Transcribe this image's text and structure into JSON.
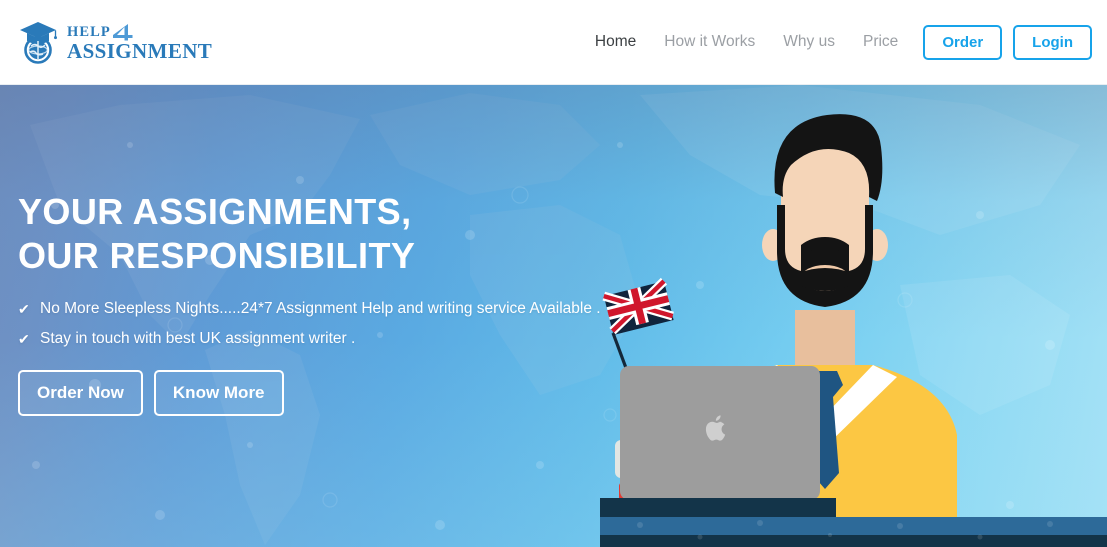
{
  "header": {
    "logo": {
      "icon": "globe-graduation-cap-icon",
      "top_text": "HELP",
      "numeral": "4",
      "bottom_text": "ASSIGNMENT",
      "color": "#2a7ab9"
    },
    "nav_links": [
      {
        "label": "Home",
        "active": true
      },
      {
        "label": "How it Works",
        "active": false
      },
      {
        "label": "Why us",
        "active": false
      },
      {
        "label": "Price",
        "active": false
      }
    ],
    "buttons": [
      {
        "label": "Order",
        "name": "order-button"
      },
      {
        "label": "Login",
        "name": "login-button"
      }
    ],
    "accent_color": "#17a3ea",
    "background": "#ffffff"
  },
  "hero": {
    "title_line1": "YOUR ASSIGNMENTS,",
    "title_line2": "OUR RESPONSIBILITY",
    "bullets": [
      {
        "icon": "check-icon",
        "text": "No More Sleepless Nights.....24*7 Assignment Help and writing service Available ."
      },
      {
        "icon": "check-icon",
        "text": "Stay in touch with best UK assignment writer ."
      }
    ],
    "buttons": [
      {
        "label": "Order Now",
        "name": "order-now-button"
      },
      {
        "label": "Know More",
        "name": "know-more-button"
      }
    ],
    "background_gradient_from": "#6f8fc0",
    "background_gradient_to": "#a6e2f6",
    "text_color": "#ffffff",
    "illustration": {
      "description": "flat-illustration of bearded man at desk with laptop, books and UK flag",
      "hair_color": "#141414",
      "skin_color": "#f5d5b8",
      "sweater_color": "#fcc743",
      "shirt_color": "#ffffff",
      "tie_color": "#1f5582",
      "laptop_color": "#9d9d9d",
      "laptop_logo": "apple-logo-icon",
      "desk_color": "#2d6a99",
      "desk_front_color": "#133449",
      "book_top_color": "#2d6a99",
      "book_middle_color": "#f7f7f4",
      "book_bottom_color": "#e23b32",
      "bookmark_color": "#fcc743",
      "flag": "uk-flag-icon"
    }
  }
}
